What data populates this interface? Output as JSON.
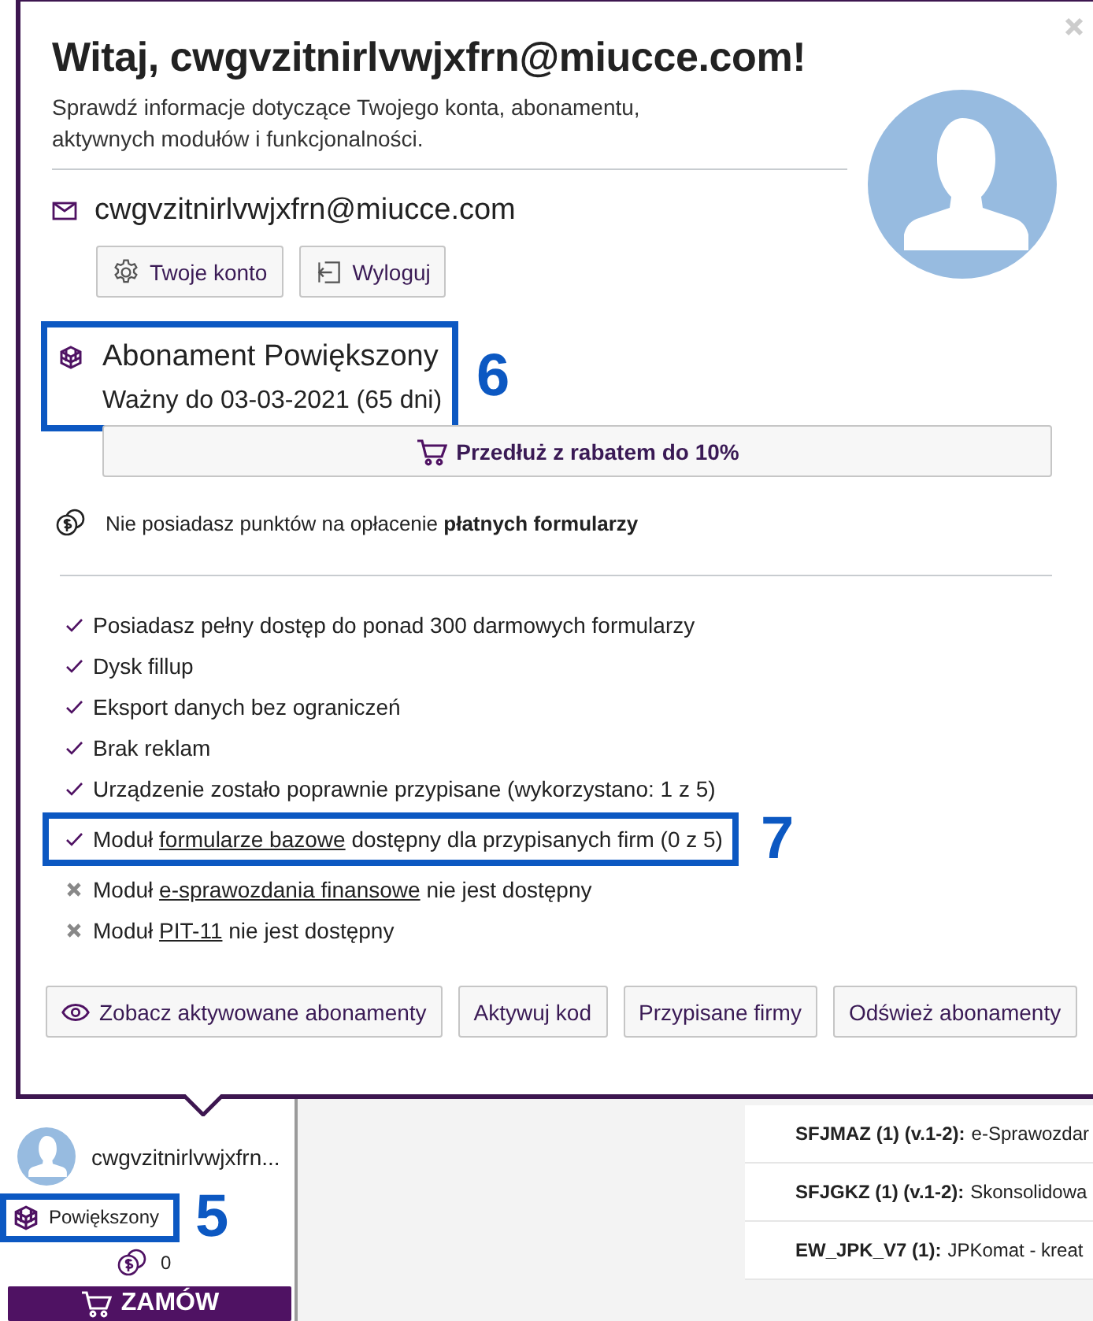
{
  "dialog": {
    "title": "Witaj, cwgvzitnirlvwjxfrn@miucce.com!",
    "subtitle": "Sprawdź informacje dotyczące Twojego konta, abonamentu, aktywnych modułów i funkcjonalności.",
    "email": "cwgvzitnirlvwjxfrn@miucce.com",
    "account_buttons": [
      {
        "kind": "gear",
        "label": "Twoje konto"
      },
      {
        "kind": "logout",
        "label": "Wyloguj"
      }
    ],
    "plan": {
      "name": "Abonament Powiększony",
      "valid": "Ważny do 03-03-2021 (65 dni)",
      "callout": "6"
    },
    "extend_button": "Przedłuż z rabatem do 10%",
    "points_note": "Nie posiadasz punktów na opłacenie **płatnych formularzy**",
    "features": [
      {
        "available": true,
        "text": "Posiadasz pełny dostęp do ponad 300 darmowych formularzy"
      },
      {
        "available": true,
        "text": "Dysk fillup"
      },
      {
        "available": true,
        "text": "Eksport danych bez ograniczeń"
      },
      {
        "available": true,
        "text": "Brak reklam"
      },
      {
        "available": true,
        "text": "Urządzenie zostało poprawnie przypisane (wykorzystano: 1 z 5)"
      },
      {
        "available": true,
        "text": "Moduł",
        "link": "formularze bazowe",
        "suffix": "dostępny dla przypisanych firm (0 z 5)",
        "callout": "7"
      },
      {
        "available": false,
        "text": "Moduł",
        "link": "e-sprawozdania finansowe",
        "suffix": "nie jest dostępny"
      },
      {
        "available": false,
        "text": "Moduł",
        "link": "PIT-11",
        "suffix": "nie jest dostępny"
      }
    ],
    "footer_buttons": [
      {
        "kind": "eye",
        "label": "Zobacz aktywowane abonamenty"
      },
      {
        "kind": "plain",
        "label": "Aktywuj kod"
      },
      {
        "kind": "plain",
        "label": "Przypisane firmy"
      },
      {
        "kind": "plain",
        "label": "Odśwież abonamenty"
      }
    ]
  },
  "sidebar": {
    "user": "cwgvzitnirlvwjxfrn...",
    "plan": "Powiększony",
    "plan_callout": "5",
    "points": "0",
    "order_button": "ZAMÓW"
  },
  "documents": [
    {
      "code": "SFJMAZ (1) (v.1-2):",
      "title": "e-Sprawozdar"
    },
    {
      "code": "SFJGKZ (1) (v.1-2):",
      "title": "Skonsolidowa"
    },
    {
      "code": "EW_JPK_V7 (1):",
      "title": "JPKomat - kreat"
    }
  ]
}
